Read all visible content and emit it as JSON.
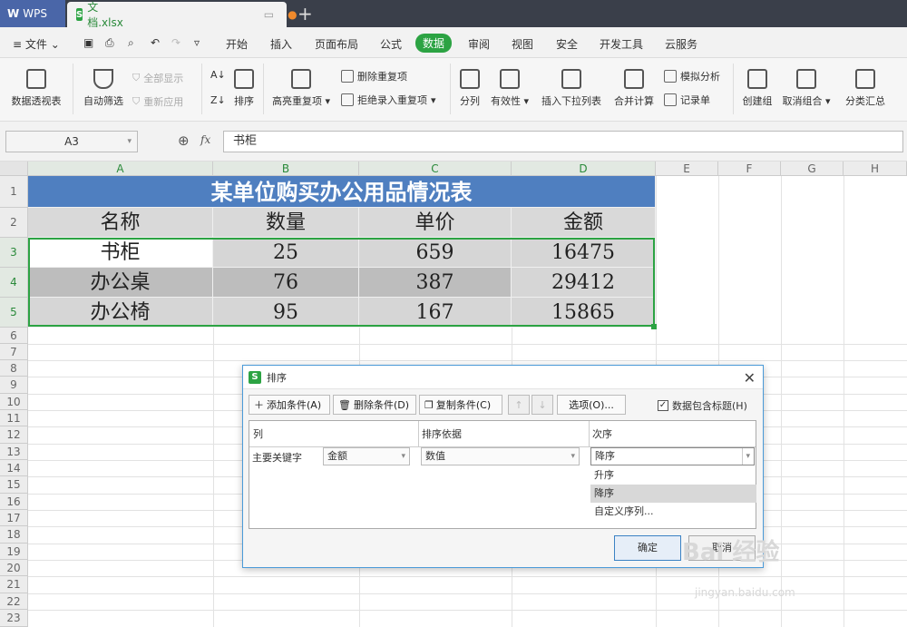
{
  "tabs": {
    "app": "WPS",
    "document": "文档.xlsx"
  },
  "menu": {
    "file": "文件",
    "items": [
      "开始",
      "插入",
      "页面布局",
      "公式",
      "数据",
      "审阅",
      "视图",
      "安全",
      "开发工具",
      "云服务"
    ],
    "active": "数据"
  },
  "ribbon": {
    "pivot": "数据透视表",
    "autofilter": "自动筛选",
    "show_all": "全部显示",
    "reapply": "重新应用",
    "sort": "排序",
    "highlight_dup": "高亮重复项",
    "remove_dup": "删除重复项",
    "reject_dup": "拒绝录入重复项",
    "split": "分列",
    "validity": "有效性",
    "dropdown": "插入下拉列表",
    "consolidate": "合并计算",
    "simulate": "模拟分析",
    "record": "记录单",
    "group": "创建组",
    "ungroup": "取消组合",
    "subtotal": "分类汇总"
  },
  "formula": {
    "namebox": "A3",
    "fx": "fx",
    "content": "书柜"
  },
  "columns": [
    "A",
    "B",
    "C",
    "D",
    "E",
    "F",
    "G",
    "H"
  ],
  "rows": [
    "1",
    "2",
    "3",
    "4",
    "5",
    "6",
    "7",
    "8",
    "9",
    "10",
    "11",
    "12",
    "13",
    "14",
    "15",
    "16",
    "17",
    "18",
    "19",
    "20",
    "21",
    "22",
    "23"
  ],
  "table": {
    "title": "某单位购买办公用品情况表",
    "headers": [
      "名称",
      "数量",
      "单价",
      "金额"
    ],
    "rows": [
      [
        "书柜",
        "25",
        "659",
        "16475"
      ],
      [
        "办公桌",
        "76",
        "387",
        "29412"
      ],
      [
        "办公椅",
        "95",
        "167",
        "15865"
      ]
    ]
  },
  "dialog": {
    "title": "排序",
    "add": "添加条件(A)",
    "delete": "删除条件(D)",
    "copy": "复制条件(C)",
    "options": "选项(O)...",
    "has_header": "数据包含标题(H)",
    "col_header": "列",
    "basis_header": "排序依据",
    "order_header": "次序",
    "primary_key": "主要关键字",
    "key_value": "金额",
    "basis_value": "数值",
    "order_value": "降序",
    "order_options": [
      "升序",
      "降序",
      "自定义序列..."
    ],
    "ok": "确定",
    "cancel": "取消"
  },
  "watermark": {
    "main": "Bai 经验",
    "sub": "jingyan.baidu.com"
  },
  "colors": {
    "accent": "#2ca343",
    "title_bg": "#4f7fc0",
    "header_bg": "#d9d9d9"
  }
}
